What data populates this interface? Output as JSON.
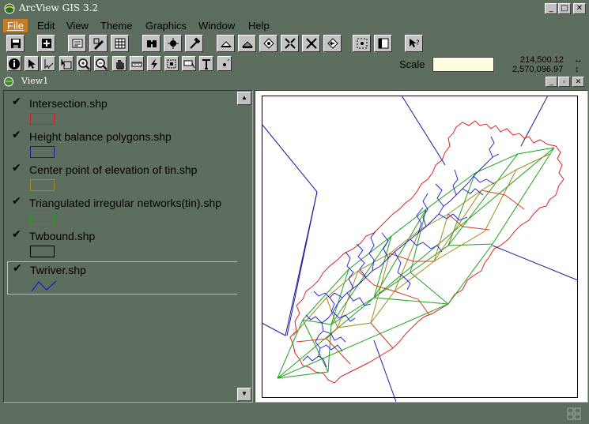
{
  "app": {
    "title": "ArcView GIS 3.2",
    "window_buttons": [
      "_",
      "□",
      "✕"
    ]
  },
  "menu": [
    {
      "key": "file",
      "label": "File",
      "active": true
    },
    {
      "key": "edit",
      "label": "Edit"
    },
    {
      "key": "view",
      "label": "View"
    },
    {
      "key": "theme",
      "label": "Theme"
    },
    {
      "key": "graphics",
      "label": "Graphics"
    },
    {
      "key": "window",
      "label": "Window"
    },
    {
      "key": "help",
      "label": "Help"
    }
  ],
  "toolbar": {
    "buttons": [
      "save-icon",
      "add-theme-icon",
      "theme-properties-icon",
      "edit-legend-icon",
      "open-table-icon",
      "find-icon",
      "locate-address-icon",
      "query-builder-icon",
      "zoom-full-extent-icon",
      "zoom-active-themes-icon",
      "zoom-selected-icon",
      "zoom-in-fixed-icon",
      "zoom-out-fixed-icon",
      "zoom-previous-icon",
      "select-by-theme-icon",
      "clear-selection-icon",
      "help-icon"
    ]
  },
  "tools": {
    "buttons": [
      "identify-icon",
      "pointer-icon",
      "vertex-edit-icon",
      "select-feature-icon",
      "zoom-in-icon",
      "zoom-out-icon",
      "pan-icon",
      "measure-icon",
      "hotlink-icon",
      "area-of-interest-icon",
      "label-icon",
      "text-icon",
      "draw-point-icon"
    ]
  },
  "scale": {
    "label": "Scale",
    "value": ""
  },
  "coordinates": {
    "x": "214,500.12",
    "y": "2,570,096.97",
    "x_arrow": "↔",
    "y_arrow": "↕"
  },
  "view": {
    "title": "View1",
    "buttons": [
      "_",
      "▫",
      "✕"
    ]
  },
  "legend": [
    {
      "name": "Intersection.shp",
      "checked": true,
      "symbol": "polygon",
      "color": "#e02020"
    },
    {
      "name": "Height balance polygons.shp",
      "checked": true,
      "symbol": "polygon",
      "color": "#1a1aa0"
    },
    {
      "name": "Center point of elevation of tin.shp",
      "checked": true,
      "symbol": "polygon",
      "color": "#a08a20"
    },
    {
      "name": "Triangulated irregular networks(tin).shp",
      "checked": true,
      "symbol": "polygon",
      "color": "#20a020"
    },
    {
      "name": "Twbound.shp",
      "checked": true,
      "symbol": "polygon",
      "color": "#000000"
    },
    {
      "name": "Twriver.shp",
      "checked": true,
      "symbol": "line",
      "color": "#1a1ad0"
    }
  ],
  "check_glyph": "✔",
  "scroll_glyphs": {
    "up": "▲",
    "down": "▼"
  },
  "colors": {
    "window_bg": "#5e6e5e",
    "menu_active": "#c87a25",
    "scale_field": "#fffde0",
    "map_bg": "#ffffff"
  }
}
